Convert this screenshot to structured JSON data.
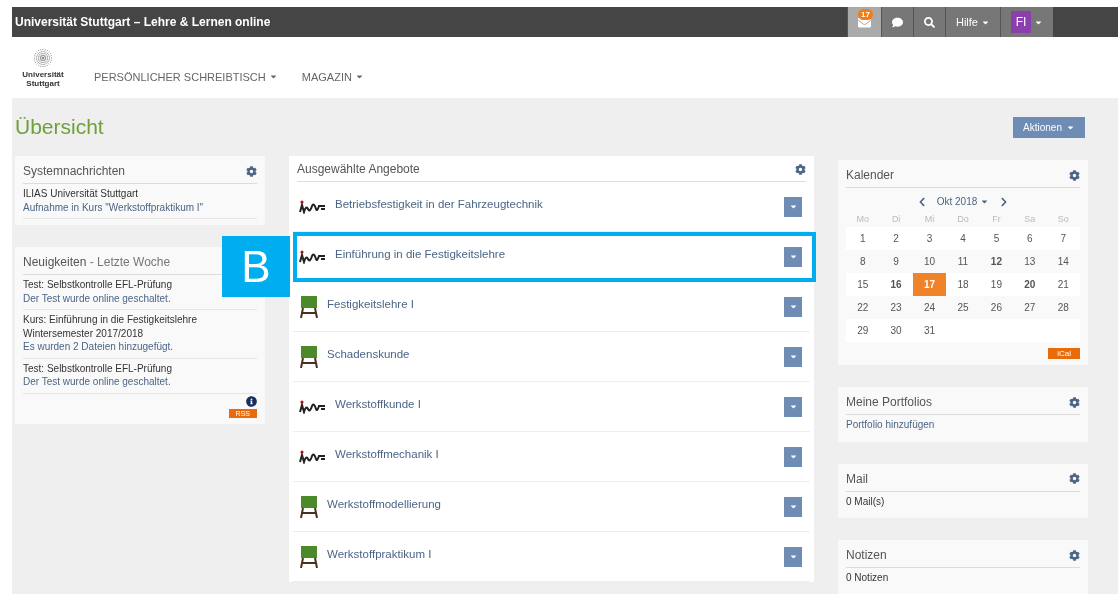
{
  "topbar": {
    "title": "Universität Stuttgart – Lehre & Lernen online",
    "mail_badge": "17",
    "help": "Hilfe",
    "avatar": "FI"
  },
  "header": {
    "logo_text": "Universität Stuttgart",
    "nav": [
      {
        "label": "PERSÖNLICHER SCHREIBTISCH"
      },
      {
        "label": "MAGAZIN"
      }
    ]
  },
  "page": {
    "title": "Übersicht",
    "actions": "Aktionen"
  },
  "system_messages": {
    "title": "Systemnachrichten",
    "items": [
      {
        "title": "ILIAS Universität Stuttgart",
        "text": "Aufnahme in Kurs \"Werkstoffpraktikum I\""
      }
    ]
  },
  "news": {
    "title": "Neuigkeiten",
    "subtitle": "- Letzte Woche",
    "items": [
      {
        "title": "Test: Selbstkontrolle EFL-Prüfung",
        "text": "Der Test wurde online geschaltet."
      },
      {
        "title": "Kurs: Einführung in die Festigkeitslehre Wintersemester 2017/2018",
        "text": "Es wurden 2 Dateien hinzugefügt."
      },
      {
        "title": "Test: Selbstkontrolle EFL-Prüfung",
        "text": "Der Test wurde online geschaltet."
      }
    ],
    "rss": "RSS"
  },
  "offers": {
    "title": "Ausgewählte Angebote",
    "items": [
      {
        "kind": "group",
        "label": "Betriebsfestigkeit in der Fahrzeugtechnik",
        "highlighted": false
      },
      {
        "kind": "group",
        "label": "Einführung in die Festigkeitslehre",
        "highlighted": true
      },
      {
        "kind": "course",
        "label": "Festigkeitslehre I",
        "highlighted": false
      },
      {
        "kind": "course",
        "label": "Schadenskunde",
        "highlighted": false
      },
      {
        "kind": "group",
        "label": "Werkstoffkunde I",
        "highlighted": false
      },
      {
        "kind": "group",
        "label": "Werkstoffmechanik I",
        "highlighted": false
      },
      {
        "kind": "course",
        "label": "Werkstoffmodellierung",
        "highlighted": false
      },
      {
        "kind": "course",
        "label": "Werkstoffpraktikum I",
        "highlighted": false
      }
    ]
  },
  "callout": {
    "label": "B"
  },
  "calendar": {
    "title": "Kalender",
    "month": "Okt 2018",
    "weekdays": [
      "Mo",
      "Di",
      "Mi",
      "Do",
      "Fr",
      "Sa",
      "So"
    ],
    "weeks": [
      [
        {
          "day": "1",
          "bold": false,
          "today": false
        },
        {
          "day": "2",
          "bold": false,
          "today": false
        },
        {
          "day": "3",
          "bold": false,
          "today": false
        },
        {
          "day": "4",
          "bold": false,
          "today": false
        },
        {
          "day": "5",
          "bold": false,
          "today": false
        },
        {
          "day": "6",
          "bold": false,
          "today": false
        },
        {
          "day": "7",
          "bold": false,
          "today": false
        }
      ],
      [
        {
          "day": "8",
          "bold": false,
          "today": false
        },
        {
          "day": "9",
          "bold": false,
          "today": false
        },
        {
          "day": "10",
          "bold": false,
          "today": false
        },
        {
          "day": "11",
          "bold": false,
          "today": false
        },
        {
          "day": "12",
          "bold": true,
          "today": false
        },
        {
          "day": "13",
          "bold": false,
          "today": false
        },
        {
          "day": "14",
          "bold": false,
          "today": false
        }
      ],
      [
        {
          "day": "15",
          "bold": false,
          "today": false
        },
        {
          "day": "16",
          "bold": true,
          "today": false
        },
        {
          "day": "17",
          "bold": true,
          "today": true
        },
        {
          "day": "18",
          "bold": false,
          "today": false
        },
        {
          "day": "19",
          "bold": false,
          "today": false
        },
        {
          "day": "20",
          "bold": true,
          "today": false
        },
        {
          "day": "21",
          "bold": false,
          "today": false
        }
      ],
      [
        {
          "day": "22",
          "bold": false,
          "today": false
        },
        {
          "day": "23",
          "bold": false,
          "today": false
        },
        {
          "day": "24",
          "bold": false,
          "today": false
        },
        {
          "day": "25",
          "bold": false,
          "today": false
        },
        {
          "day": "26",
          "bold": false,
          "today": false
        },
        {
          "day": "27",
          "bold": false,
          "today": false
        },
        {
          "day": "28",
          "bold": false,
          "today": false
        }
      ],
      [
        {
          "day": "29",
          "bold": false,
          "today": false
        },
        {
          "day": "30",
          "bold": false,
          "today": false
        },
        {
          "day": "31",
          "bold": false,
          "today": false
        }
      ]
    ],
    "ical": "iCal"
  },
  "blocks": [
    {
      "title": "Meine Portfolios",
      "text": "Portfolio hinzufügen",
      "link": true
    },
    {
      "title": "Mail",
      "text": "0 Mail(s)",
      "link": false
    },
    {
      "title": "Notizen",
      "text": "0 Notizen",
      "link": false
    }
  ]
}
